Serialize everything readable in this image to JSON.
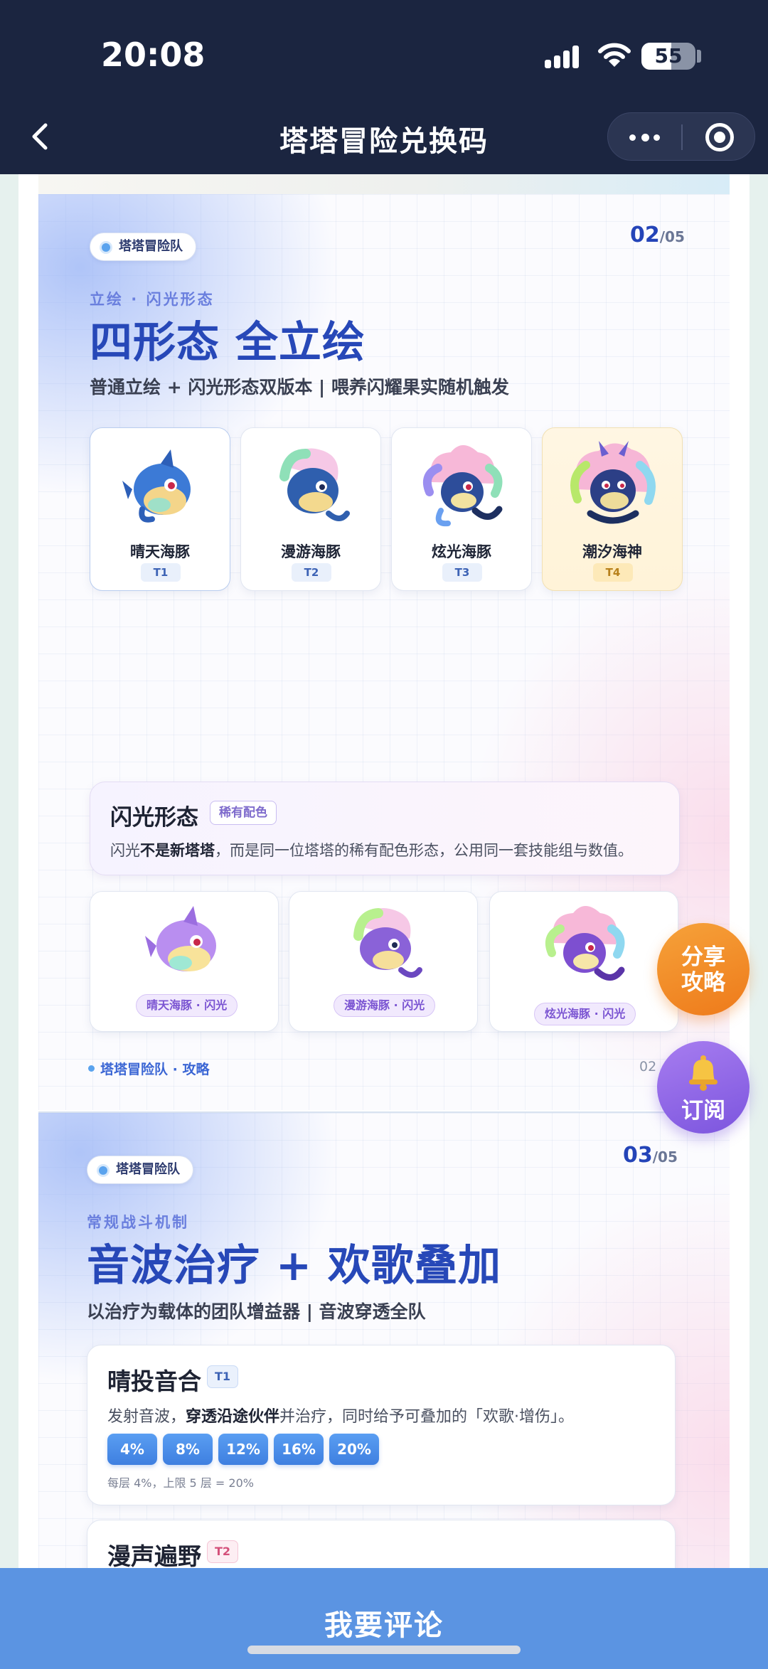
{
  "status_bar": {
    "time": "20:08",
    "battery": "55",
    "battery_level": 0.55
  },
  "nav": {
    "title": "塔塔冒险兑换码"
  },
  "slide2": {
    "tag": "塔塔冒险队",
    "page_current": "02",
    "page_total": "/05",
    "kicker": "立绘 · 闪光形态",
    "title": "四形态 全立绘",
    "subtitle": "普通立绘 + 闪光形态双版本 | 喂养闪耀果实随机触发",
    "forms": [
      {
        "name": "晴天海豚",
        "tier": "T1"
      },
      {
        "name": "漫游海豚",
        "tier": "T2"
      },
      {
        "name": "炫光海豚",
        "tier": "T3"
      },
      {
        "name": "潮汐海神",
        "tier": "T4"
      }
    ],
    "shiny_box": {
      "title": "闪光形态",
      "tag": "稀有配色",
      "desc_prefix": "闪光",
      "desc_bold": "不是新塔塔",
      "desc_suffix": "，而是同一位塔塔的稀有配色形态，公用同一套技能组与数值。"
    },
    "shiny_forms": [
      {
        "label": "晴天海豚 · 闪光"
      },
      {
        "label": "漫游海豚 · 闪光"
      },
      {
        "label": "炫光海豚 · 闪光"
      }
    ],
    "footer_label": "塔塔冒险队 · 攻略",
    "footer_num": "02"
  },
  "slide3": {
    "tag": "塔塔冒险队",
    "page_current": "03",
    "page_total": "/05",
    "kicker": "常规战斗机制",
    "title": "音波治疗 + 欢歌叠加",
    "subtitle": "以治疗为载体的团队增益器 | 音波穿透全队",
    "skills": [
      {
        "title": "晴投音合",
        "tier": "T1",
        "desc_prefix": "发射音波，",
        "desc_bold": "穿透沿途伙伴",
        "desc_suffix": "并治疗，同时给予可叠加的「欢歌·增伤」。",
        "chips": [
          "4%",
          "8%",
          "12%",
          "16%",
          "20%"
        ],
        "note": "每层 4%，上限 5 层 = 20%"
      },
      {
        "title": "漫声遍野",
        "tier": "T2"
      }
    ]
  },
  "fab": {
    "share_line1": "分享",
    "share_line2": "攻略",
    "subscribe": "订阅"
  },
  "bottom_bar": {
    "comment_label": "我要评论"
  },
  "colors": {
    "nav_bg": "#1b2540",
    "brand_blue": "#2748b8",
    "accent_blue": "#5b94e2",
    "share_orange": "#ee7a1a",
    "subscribe_purple": "#7c55de",
    "gold": "#b7801b"
  },
  "icons": [
    "back-arrow-icon",
    "more-dots-icon",
    "close-target-icon",
    "signal-icon",
    "wifi-icon",
    "battery-icon",
    "bell-icon"
  ]
}
